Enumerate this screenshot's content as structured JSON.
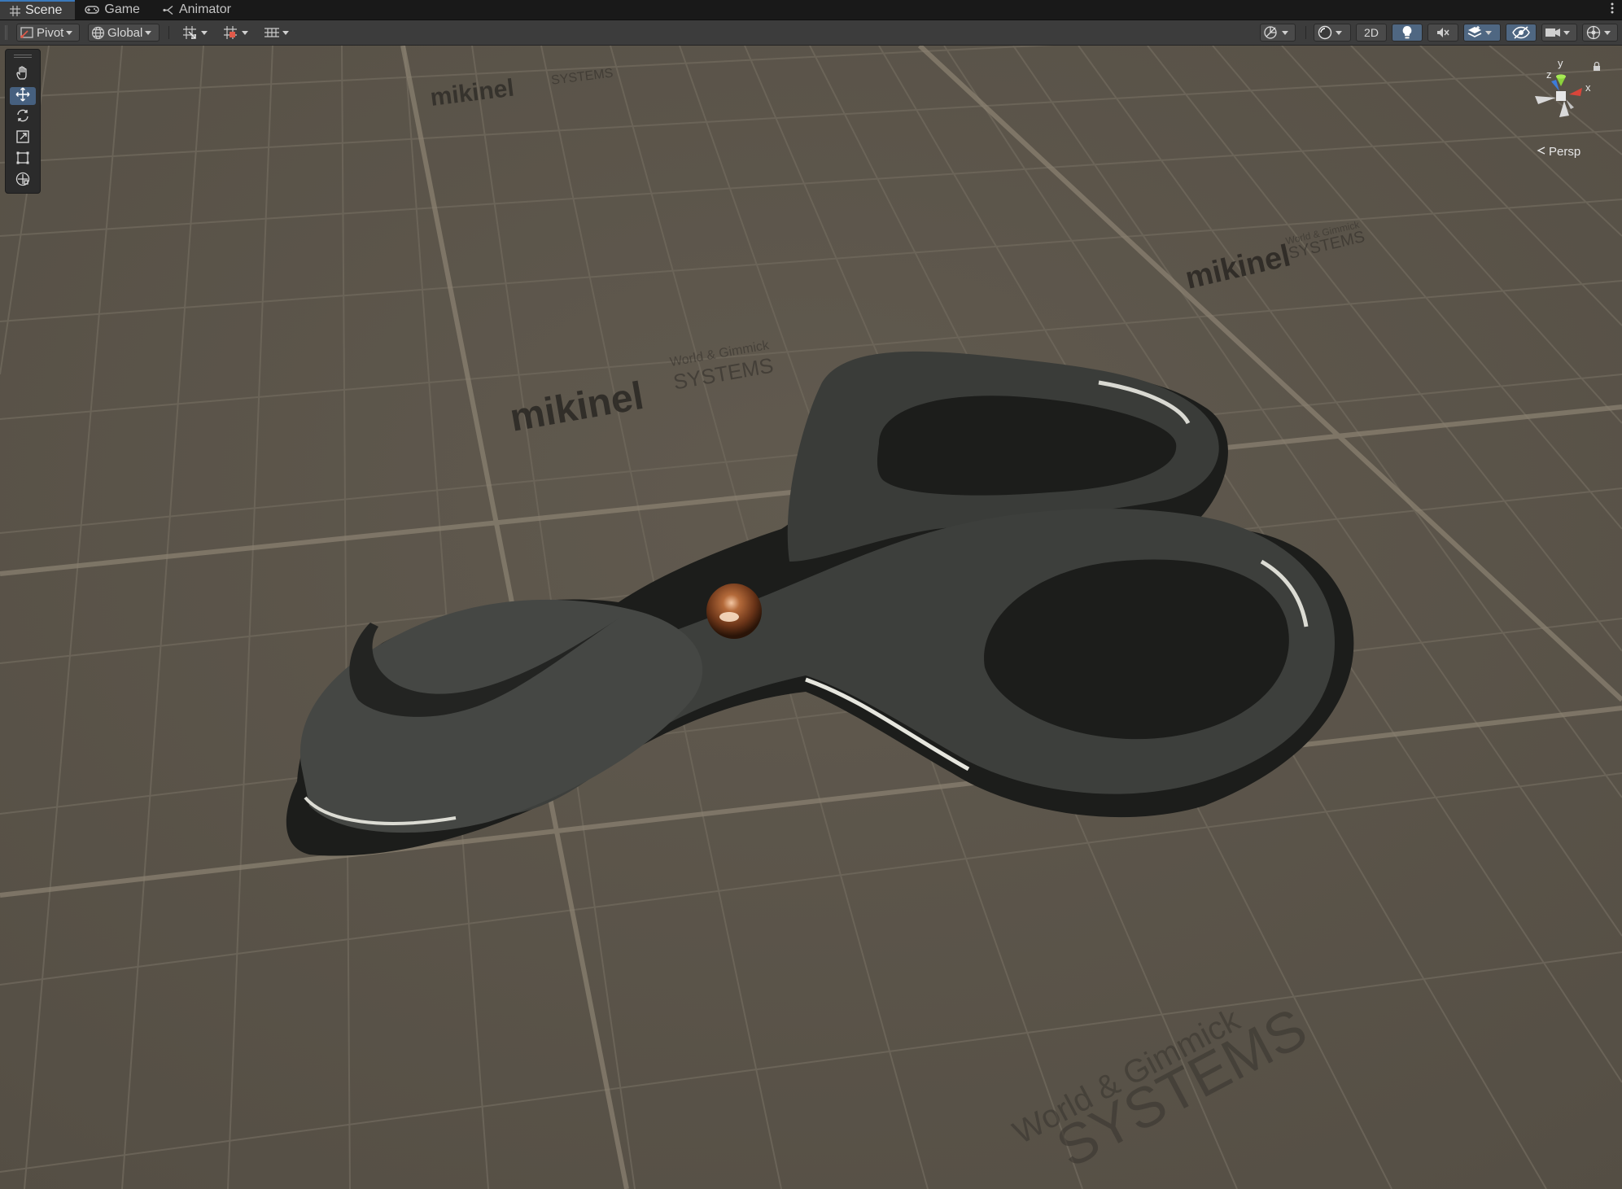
{
  "tabs": [
    {
      "label": "Scene",
      "icon": "grid-icon",
      "active": true
    },
    {
      "label": "Game",
      "icon": "gamepad-icon",
      "active": false
    },
    {
      "label": "Animator",
      "icon": "animator-icon",
      "active": false
    }
  ],
  "toolbar": {
    "pivot_label": "Pivot",
    "global_label": "Global",
    "mode_2d_label": "2D"
  },
  "tools": [
    {
      "name": "hand-tool",
      "icon": "hand-icon",
      "active": false
    },
    {
      "name": "move-tool",
      "icon": "move-icon",
      "active": true
    },
    {
      "name": "rotate-tool",
      "icon": "rotate-icon",
      "active": false
    },
    {
      "name": "scale-tool",
      "icon": "scale-icon",
      "active": false
    },
    {
      "name": "rect-tool",
      "icon": "rect-transform-icon",
      "active": false
    },
    {
      "name": "transform-tool",
      "icon": "transform-icon",
      "active": false
    }
  ],
  "gizmo": {
    "axis_x": "x",
    "axis_y": "y",
    "axis_z": "z",
    "projection_label": "Persp"
  },
  "scene": {
    "watermark_brand": "mikinel",
    "watermark_systems": "SYSTEMS",
    "watermark_tagline": "World & Gimmick",
    "object": "scissors-model"
  },
  "colors": {
    "accent": "#3a79bb",
    "active_button": "#4f6782",
    "floor": "#5a544a",
    "grid_line": "#8a8070",
    "scissors": "#3b3d3a",
    "rivet": "#8a4a22",
    "axis_x": "#d9453a",
    "axis_y": "#8bd23c",
    "axis_z": "#3d7bd9"
  }
}
